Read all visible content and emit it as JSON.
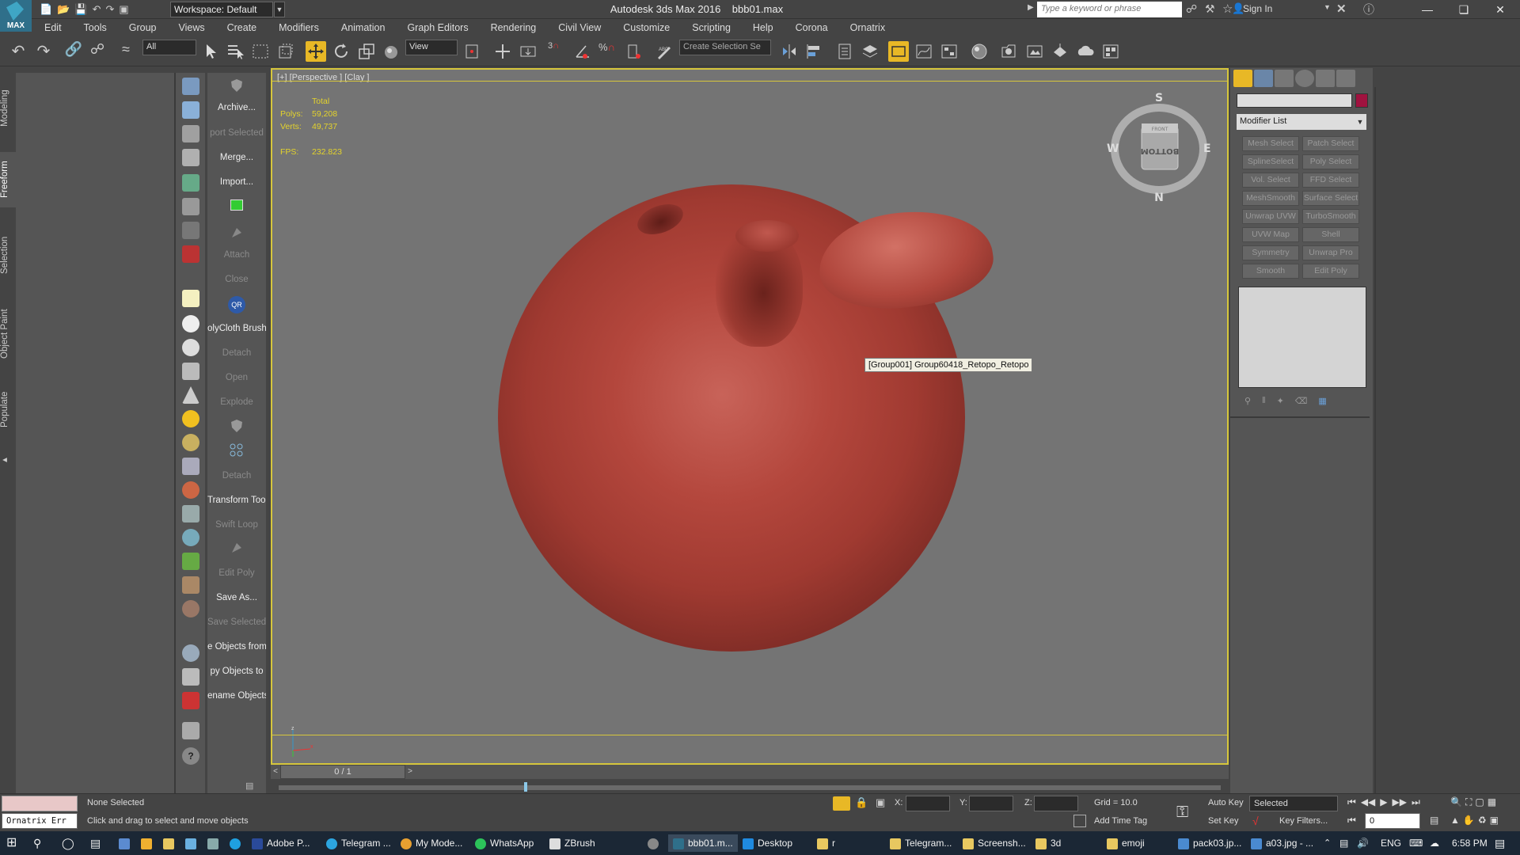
{
  "app": {
    "title": "Autodesk 3ds Max 2016",
    "filename": "bbb01.max",
    "workspace": "Workspace: Default",
    "search_placeholder": "Type a keyword or phrase",
    "signin": "Sign In"
  },
  "menu": [
    "Edit",
    "Tools",
    "Group",
    "Views",
    "Create",
    "Modifiers",
    "Animation",
    "Graph Editors",
    "Rendering",
    "Civil View",
    "Customize",
    "Scripting",
    "Help",
    "Corona",
    "Ornatrix"
  ],
  "toolbar": {
    "selection_filter": "All",
    "ref_coord": "View",
    "named_selection": "Create Selection Se"
  },
  "ribbon_tabs": [
    "Modeling",
    "Freeform",
    "Selection",
    "Object Paint",
    "Populate"
  ],
  "orbit_tools": [
    {
      "label": "Archive...",
      "dim": false
    },
    {
      "label": "port Selected",
      "dim": true
    },
    {
      "label": "Merge...",
      "dim": false
    },
    {
      "label": "Import...",
      "dim": false
    },
    {
      "label": "Attach",
      "dim": true
    },
    {
      "label": "Close",
      "dim": true
    },
    {
      "label": "olyCloth Brush",
      "dim": false
    },
    {
      "label": "Detach",
      "dim": true
    },
    {
      "label": "Open",
      "dim": true
    },
    {
      "label": "Explode",
      "dim": true
    },
    {
      "label": "Detach",
      "dim": true
    },
    {
      "label": "Transform Tool",
      "dim": false
    },
    {
      "label": "Swift Loop",
      "dim": true
    },
    {
      "label": "Edit Poly",
      "dim": true
    },
    {
      "label": "Save As...",
      "dim": false
    },
    {
      "label": "Save Selected",
      "dim": true
    },
    {
      "label": "e Objects from",
      "dim": false
    },
    {
      "label": "py Objects to",
      "dim": false
    },
    {
      "label": "ename Objects",
      "dim": false
    }
  ],
  "viewport": {
    "label": "[+] [Perspective ] [Clay ]",
    "stats_header": "Total",
    "polys_label": "Polys:",
    "polys_value": "59,208",
    "verts_label": "Verts:",
    "verts_value": "49,737",
    "fps_label": "FPS:",
    "fps_value": "232.823",
    "tooltip": "[Group001] Group60418_Retopo_Retopo",
    "viewcube": {
      "n": "N",
      "s": "S",
      "e": "E",
      "w": "W",
      "face": "BOTTOM",
      "top_face": "FRONT"
    }
  },
  "timeslider": {
    "position": "0 / 1"
  },
  "command_panel": {
    "modifier_list": "Modifier List",
    "buttons": [
      [
        "Mesh Select",
        "Patch Select"
      ],
      [
        "SplineSelect",
        "Poly Select"
      ],
      [
        "Vol. Select",
        "FFD Select"
      ],
      [
        "MeshSmooth",
        "Surface Select"
      ],
      [
        "Unwrap UVW",
        "TurboSmooth"
      ],
      [
        "UVW Map",
        "Shell"
      ],
      [
        "Symmetry",
        "Unwrap Pro"
      ],
      [
        "Smooth",
        "Edit Poly"
      ]
    ],
    "color_swatch": "#a0123f"
  },
  "status": {
    "script_listener": "Ornatrix Err",
    "selection": "None Selected",
    "prompt": "Click and drag to select and move objects",
    "x_label": "X:",
    "y_label": "Y:",
    "z_label": "Z:",
    "grid": "Grid = 10.0",
    "add_time_tag": "Add Time Tag",
    "auto_key": "Auto Key",
    "set_key": "Set Key",
    "key_mode": "Selected",
    "key_filters": "Key Filters...",
    "frame": "0"
  },
  "taskbar": {
    "items": [
      "Adobe P...",
      "Telegram ...",
      "My Mode...",
      "WhatsApp",
      "ZBrush",
      "bbb01.m...",
      "Desktop",
      "r",
      "Telegram...",
      "Screensh...",
      "3d",
      "emoji",
      "pack03.jp...",
      "a03.jpg - ..."
    ],
    "lang": "ENG",
    "time": "6:58 PM"
  },
  "colors": {
    "accent_border": "#d6c63c",
    "viewport_bg": "#747474",
    "object_red": "#b4473d"
  }
}
